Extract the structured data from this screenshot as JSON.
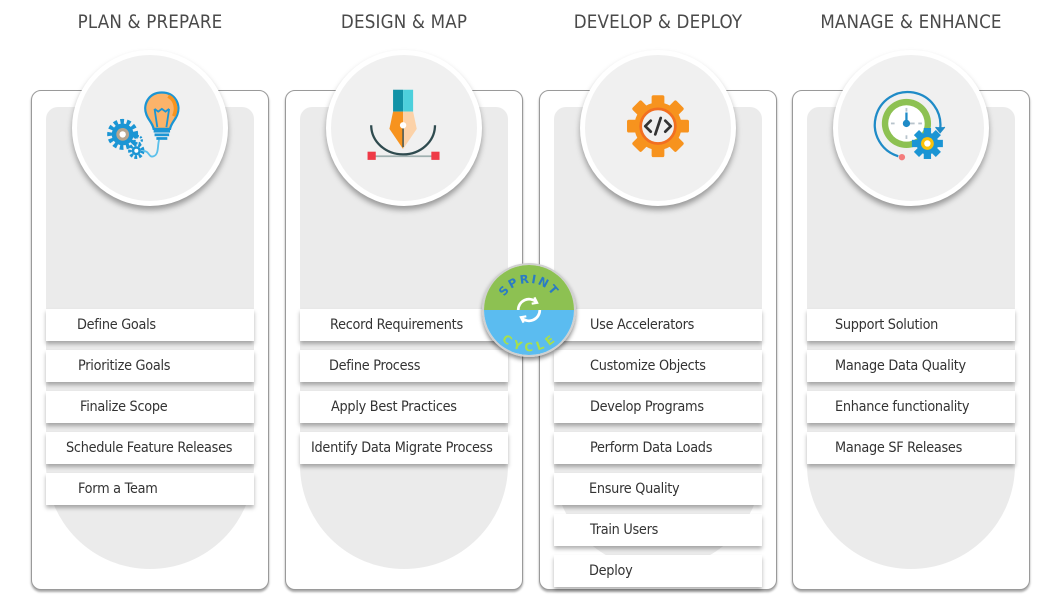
{
  "phases": [
    {
      "title": "PLAN & PREPARE",
      "icon": "lightbulb-gears-icon",
      "items": [
        "Define Goals",
        "Prioritize Goals",
        "Finalize Scope",
        "Schedule Feature Releases",
        "Form a Team"
      ]
    },
    {
      "title": "DESIGN & MAP",
      "icon": "pen-tool-icon",
      "items": [
        "Record Requirements",
        "Define Process",
        "Apply Best Practices",
        "Identify Data Migrate Process"
      ]
    },
    {
      "title": "DEVELOP & DEPLOY",
      "icon": "code-gear-icon",
      "items": [
        "Use Accelerators",
        "Customize Objects",
        "Develop Programs",
        "Perform Data Loads",
        "Ensure Quality",
        "Train Users",
        "Deploy"
      ]
    },
    {
      "title": "MANAGE & ENHANCE",
      "icon": "clock-gear-cycle-icon",
      "items": [
        "Support Solution",
        "Manage Data Quality",
        "Enhance functionality",
        "Manage SF Releases"
      ]
    }
  ],
  "badge": {
    "top_text": "SPRINT",
    "bottom_text": "CYCLE",
    "icon": "refresh-cycle-icon",
    "colors": {
      "top": "#8dc152",
      "bottom": "#5bbcf0",
      "top_text": "#2a7bc4",
      "bottom_text": "#a8e04a"
    }
  },
  "colors": {
    "title": "#4a4a4a",
    "panel": "#ebebeb",
    "card_border": "#9a9a9a",
    "orange": "#f7931e",
    "blue": "#1b95d4",
    "green": "#8dc152"
  }
}
